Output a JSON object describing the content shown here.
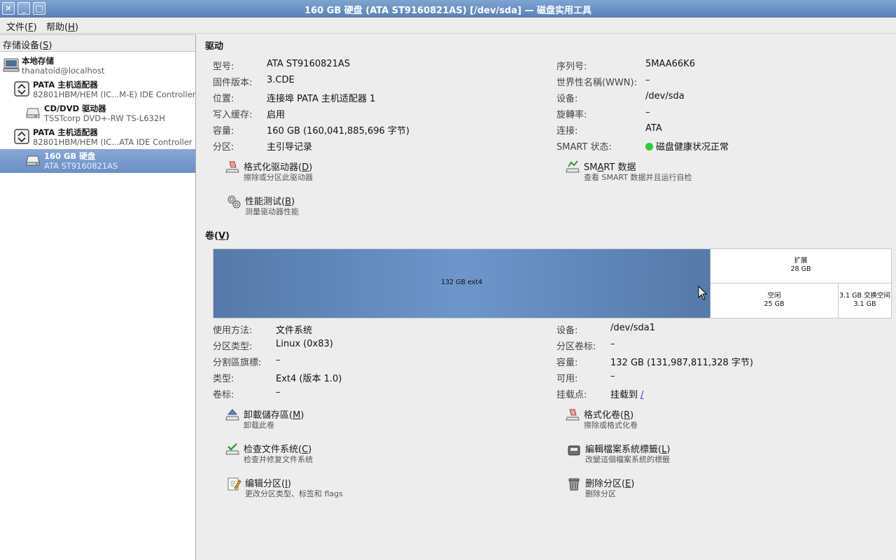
{
  "window": {
    "title": "160 GB 硬盘 (ATA ST9160821AS) [/dev/sda] — 磁盘实用工具"
  },
  "menu": {
    "file": {
      "label": "文件(",
      "acc": "F",
      "end": ")"
    },
    "help": {
      "label": "帮助(",
      "acc": "H",
      "end": ")"
    }
  },
  "sidebar": {
    "header": {
      "label": "存储设备(",
      "acc": "S",
      "end": ")"
    },
    "items": [
      {
        "title": "本地存储",
        "subtitle": "thanatoid@localhost",
        "icon": "computer-icon"
      },
      {
        "title": "PATA 主机适配器",
        "subtitle": "82801HBM/HEM (IC...M-E) IDE Controller",
        "icon": "controller-icon"
      },
      {
        "title": "CD/DVD 驱动器",
        "subtitle": "TSSTcorp DVD+-RW TS-L632H",
        "icon": "optical-drive-icon"
      },
      {
        "title": "PATA 主机适配器",
        "subtitle": "82801HBM/HEM (IC...ATA IDE Controller",
        "icon": "controller-icon"
      },
      {
        "title": "160 GB 硬盘",
        "subtitle": "ATA ST9160821AS",
        "icon": "hard-disk-icon",
        "selected": true
      }
    ]
  },
  "drive": {
    "section_title": "驱动",
    "left": [
      {
        "label": "型号:",
        "value": "ATA ST9160821AS"
      },
      {
        "label": "固件版本:",
        "value": "3.CDE"
      },
      {
        "label": "位置:",
        "value": "连接埠 PATA 主机适配器 1"
      },
      {
        "label": "写入缓存:",
        "value": "启用"
      },
      {
        "label": "容量:",
        "value": "160 GB (160,041,885,696 字节)"
      },
      {
        "label": "分区:",
        "value": "主引导记录"
      }
    ],
    "right": [
      {
        "label": "序列号:",
        "value": "5MAA66K6"
      },
      {
        "label": "世界性名稱(WWN):",
        "value": "–"
      },
      {
        "label": "设备:",
        "value": "/dev/sda"
      },
      {
        "label": "旋轉率:",
        "value": "–"
      },
      {
        "label": "连接:",
        "value": "ATA"
      },
      {
        "label": "SMART 状态:",
        "value": "磁盘健康状况正常"
      }
    ],
    "status_color": "#2ecc2e",
    "actions": {
      "format": {
        "label": "格式化驱动器(",
        "acc": "D",
        "end": ")",
        "desc": "擦除或分区此驱动器"
      },
      "smart": {
        "label": "SM",
        "acc": "A",
        "end": "RT 数据",
        "desc": "查看 SMART 数据并且运行自检"
      },
      "benchmark": {
        "label": "性能测试(",
        "acc": "B",
        "end": ")",
        "desc": "测量驱动器性能"
      }
    }
  },
  "volumes": {
    "section_title": {
      "label": "卷(",
      "acc": "V",
      "end": ")"
    },
    "map": {
      "main": {
        "line1": "132 GB ext4"
      },
      "extended": {
        "line1": "扩展",
        "line2": "28 GB"
      },
      "free": {
        "line1": "空闲",
        "line2": "25 GB"
      },
      "swap": {
        "line1": "3.1 GB 交换空间",
        "line2": "3.1 GB"
      }
    },
    "left": [
      {
        "label": "使用方法:",
        "value": "文件系统"
      },
      {
        "label": "分区类型:",
        "value": "Linux (0x83)"
      },
      {
        "label": "分割區旗標:",
        "value": "–"
      },
      {
        "label": "类型:",
        "value": "Ext4 (版本 1.0)"
      },
      {
        "label": "卷标:",
        "value": "–"
      }
    ],
    "right": [
      {
        "label": "设备:",
        "value": "/dev/sda1"
      },
      {
        "label": "分区卷标:",
        "value": "–"
      },
      {
        "label": "容量:",
        "value": "132 GB (131,987,811,328 字节)"
      },
      {
        "label": "可用:",
        "value": "–"
      },
      {
        "label": "挂载点:",
        "value": "挂载到 ",
        "link": "/"
      }
    ],
    "actions": {
      "unmount": {
        "label": "卸載儲存區(",
        "acc": "M",
        "end": ")",
        "desc": "卸载此卷"
      },
      "format_volume": {
        "label": "格式化卷(",
        "acc": "R",
        "end": ")",
        "desc": "擦除或格式化卷"
      },
      "check": {
        "label": "检查文件系统(",
        "acc": "C",
        "end": ")",
        "desc": "检查并修复文件系统"
      },
      "edit_label": {
        "label": "編輯檔案系統標籤(",
        "acc": "L",
        "end": ")",
        "desc": "改變這個檔案系統的標籤"
      },
      "edit_partition": {
        "label": "编辑分区(",
        "acc": "I",
        "end": ")",
        "desc": "更改分区类型、标签和 flags"
      },
      "delete_partition": {
        "label": "删除分区(",
        "acc": "E",
        "end": ")",
        "desc": "删除分区"
      }
    }
  }
}
